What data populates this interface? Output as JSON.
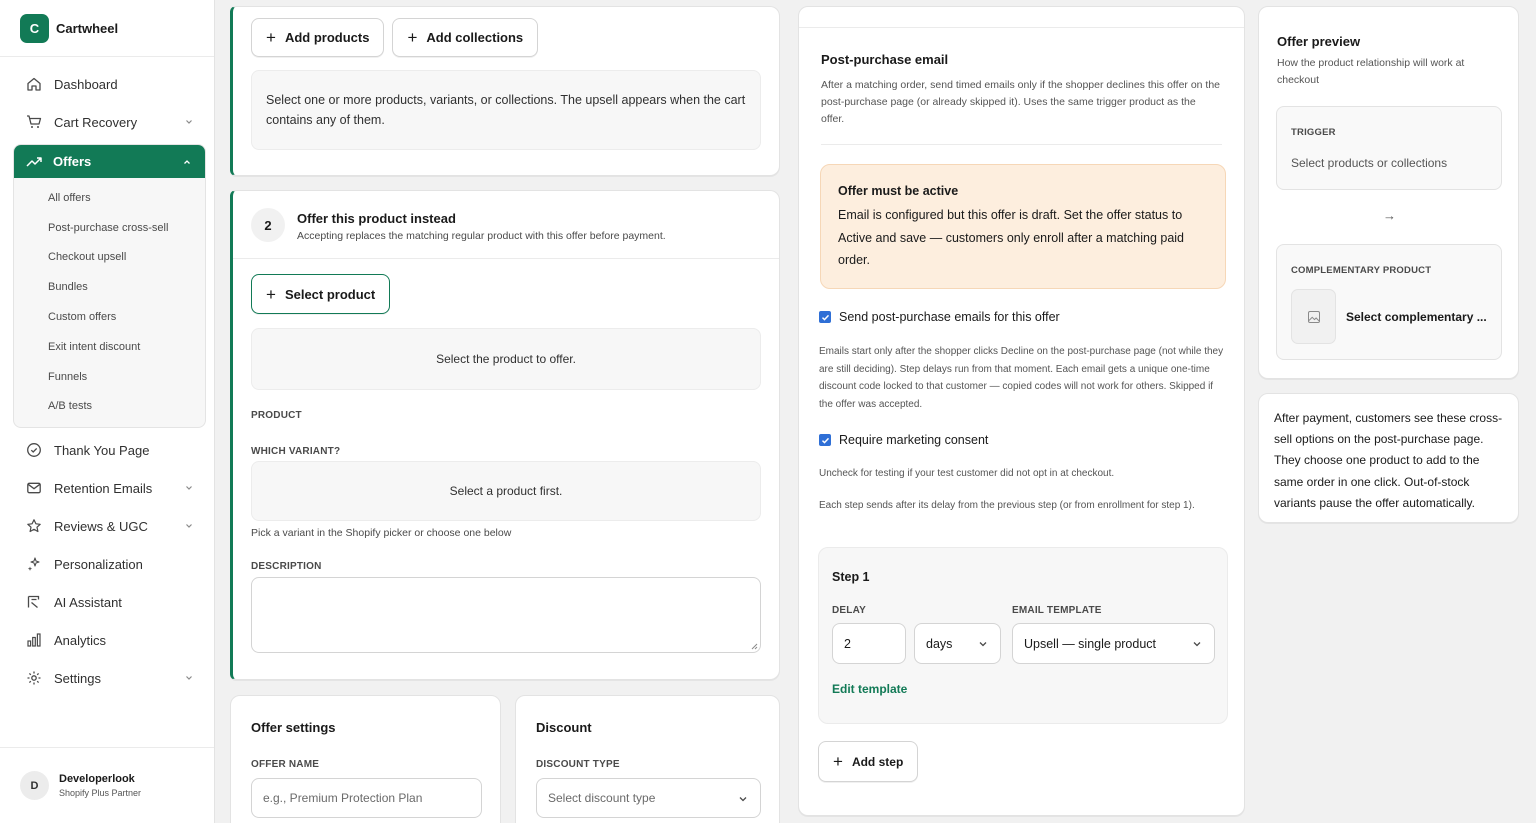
{
  "app": {
    "logo_letter": "C",
    "name": "Cartwheel"
  },
  "nav": {
    "dashboard": "Dashboard",
    "cart_recovery": "Cart Recovery",
    "offers": "Offers",
    "offers_sub": [
      "All offers",
      "Post-purchase cross-sell",
      "Checkout upsell",
      "Bundles",
      "Custom offers",
      "Exit intent discount",
      "Funnels",
      "A/B tests"
    ],
    "thank_you": "Thank You Page",
    "retention": "Retention Emails",
    "reviews": "Reviews & UGC",
    "personalization": "Personalization",
    "ai_assistant": "AI Assistant",
    "analytics": "Analytics",
    "settings": "Settings"
  },
  "user": {
    "initial": "D",
    "name": "Developerlook",
    "role": "Shopify Plus Partner"
  },
  "trigger_card": {
    "add_products": "Add products",
    "add_collections": "Add collections",
    "hint": "Select one or more products, variants, or collections. The upsell appears when the cart contains any of them."
  },
  "offer_card": {
    "step_number": "2",
    "title": "Offer this product instead",
    "subtitle": "Accepting replaces the matching regular product with this offer before payment.",
    "select_product": "Select product",
    "select_hint": "Select the product to offer.",
    "product_label": "PRODUCT",
    "variant_label": "WHICH VARIANT?",
    "variant_hint": "Select a product first.",
    "variant_help": "Pick a variant in the Shopify picker or choose one below",
    "description_label": "DESCRIPTION"
  },
  "settings_card": {
    "title": "Offer settings",
    "name_label": "OFFER NAME",
    "name_placeholder": "e.g., Premium Protection Plan"
  },
  "discount_card": {
    "title": "Discount",
    "type_label": "DISCOUNT TYPE",
    "type_value": "Select discount type"
  },
  "email_card": {
    "title": "Post-purchase email",
    "description": "After a matching order, send timed emails only if the shopper declines this offer on the post-purchase page (or already skipped it). Uses the same trigger product as the offer.",
    "warning_title": "Offer must be active",
    "warning_text": "Email is configured but this offer is draft. Set the offer status to Active and save — customers only enroll after a matching paid order.",
    "send_label": "Send post-purchase emails for this offer",
    "send_help": "Emails start only after the shopper clicks Decline on the post-purchase page (not while they are still deciding). Step delays run from that moment. Each email gets a unique one-time discount code locked to that customer — copied codes will not work for others. Skipped if the offer was accepted.",
    "consent_label": "Require marketing consent",
    "consent_help": "Uncheck for testing if your test customer did not opt in at checkout.",
    "steps_help": "Each step sends after its delay from the previous step (or from enrollment for step 1).",
    "step_title": "Step 1",
    "delay_label": "DELAY",
    "delay_value": "2",
    "delay_unit": "days",
    "template_label": "EMAIL TEMPLATE",
    "template_value": "Upsell — single product",
    "edit_template": "Edit template",
    "add_step": "Add step"
  },
  "preview_card": {
    "title": "Offer preview",
    "subtitle": "How the product relationship will work at checkout",
    "trigger_label": "TRIGGER",
    "trigger_value": "Select products or collections",
    "arrow": "→",
    "comp_label": "COMPLEMENTARY PRODUCT",
    "comp_value": "Select complementary ..."
  },
  "info_card": {
    "text": "After payment, customers see these cross-sell options on the post-purchase page. They choose one product to add to the same order in one click. Out-of-stock variants pause the offer automatically."
  },
  "colors": {
    "accent": "#127a56",
    "warning_bg": "#fdeede",
    "checkbox": "#2f6fd6"
  }
}
